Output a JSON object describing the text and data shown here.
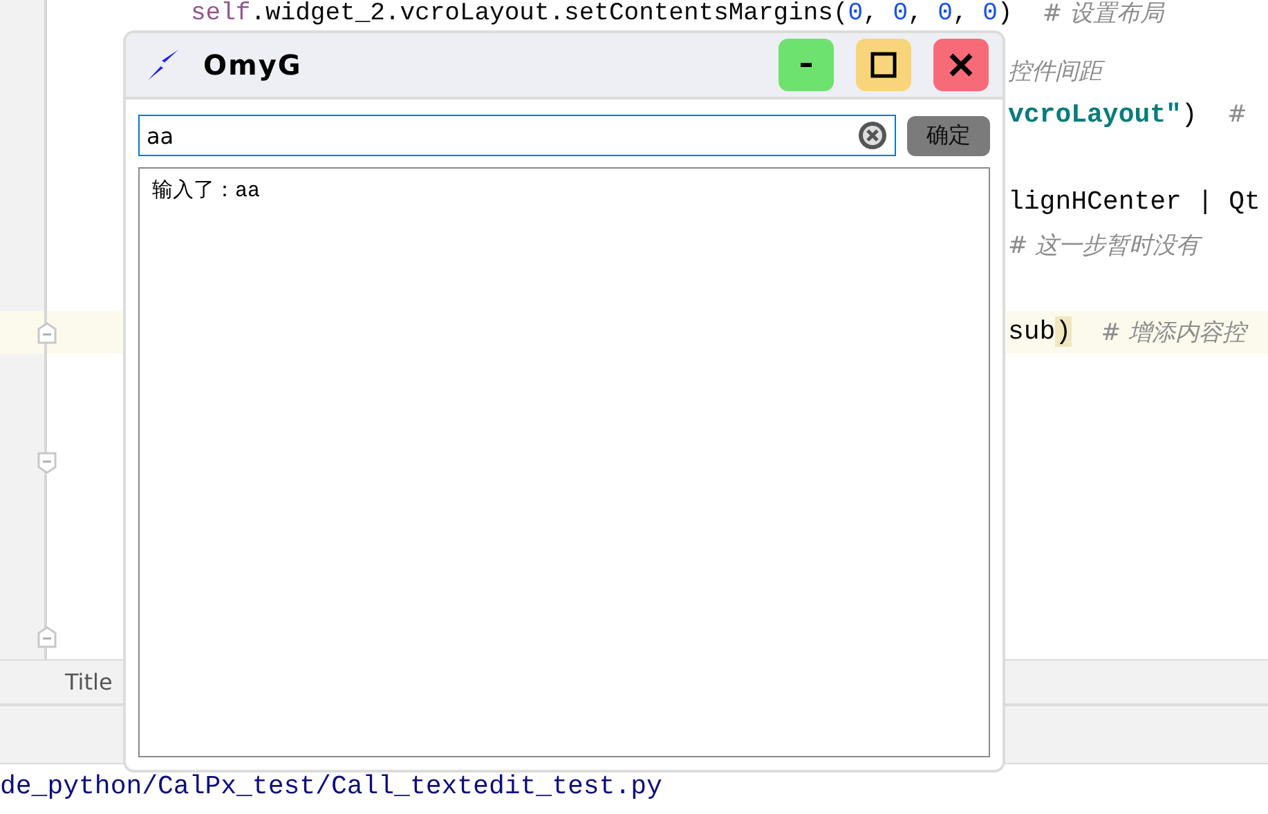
{
  "editor": {
    "lines": [
      {
        "highlighted": false,
        "kind": "plain",
        "tokens": [
          {
            "kind": "keyword",
            "text": "self"
          },
          {
            "kind": "plain",
            "text": ".widget_2.vcroLayout.setContentsMargins("
          },
          {
            "kind": "number",
            "text": "0"
          },
          {
            "kind": "plain",
            "text": ", "
          },
          {
            "kind": "number",
            "text": "0"
          },
          {
            "kind": "plain",
            "text": ", "
          },
          {
            "kind": "number",
            "text": "0"
          },
          {
            "kind": "plain",
            "text": ", "
          },
          {
            "kind": "number",
            "text": "0"
          },
          {
            "kind": "plain",
            "text": ")"
          },
          {
            "kind": "comment",
            "text": "# 设置布局"
          }
        ]
      },
      {
        "highlighted": false,
        "kind": "plain",
        "tokens": [
          {
            "kind": "comment",
            "text": "控件间距"
          }
        ]
      },
      {
        "highlighted": false,
        "kind": "plain",
        "tokens": [
          {
            "kind": "string",
            "text": "vcroLayout\""
          },
          {
            "kind": "plain",
            "text": ")"
          },
          {
            "kind": "comment",
            "text": "#"
          }
        ]
      },
      {
        "highlighted": false,
        "kind": "plain"
      },
      {
        "highlighted": false,
        "kind": "plain",
        "tokens": [
          {
            "kind": "plain",
            "text": "lignHCenter | Qt"
          }
        ]
      },
      {
        "highlighted": false,
        "kind": "plain",
        "tokens": [
          {
            "kind": "comment",
            "text": "# 这一步暂时没有"
          }
        ]
      },
      {
        "highlighted": false,
        "kind": "plain"
      },
      {
        "highlighted": true,
        "kind": "foldend",
        "tokens": [
          {
            "kind": "plain",
            "text": "sub"
          },
          {
            "kind": "bracket",
            "text": ")"
          },
          {
            "kind": "comment",
            "text": "# 增添内容控"
          }
        ]
      },
      {
        "highlighted": false,
        "kind": "plain"
      },
      {
        "highlighted": false,
        "kind": "plain"
      },
      {
        "highlighted": false,
        "kind": "foldstart"
      },
      {
        "highlighted": false,
        "kind": "plain"
      },
      {
        "highlighted": false,
        "kind": "plain"
      },
      {
        "highlighted": false,
        "kind": "plain"
      },
      {
        "highlighted": false,
        "kind": "foldend"
      }
    ]
  },
  "tool_tabs": [
    {
      "label": "Title"
    }
  ],
  "status_path": "de_python/CalPx_test/Call_textedit_test.py",
  "dialog": {
    "title": "OmyG",
    "buttons": [
      {
        "kind": "minimize",
        "color": "#6ee26e"
      },
      {
        "kind": "maximize",
        "color": "#f8d57a"
      },
      {
        "kind": "close",
        "color": "#f76b78"
      }
    ],
    "input": {
      "value": "aa",
      "focused": true
    },
    "confirm": "确定",
    "output": "输入了：aa"
  }
}
